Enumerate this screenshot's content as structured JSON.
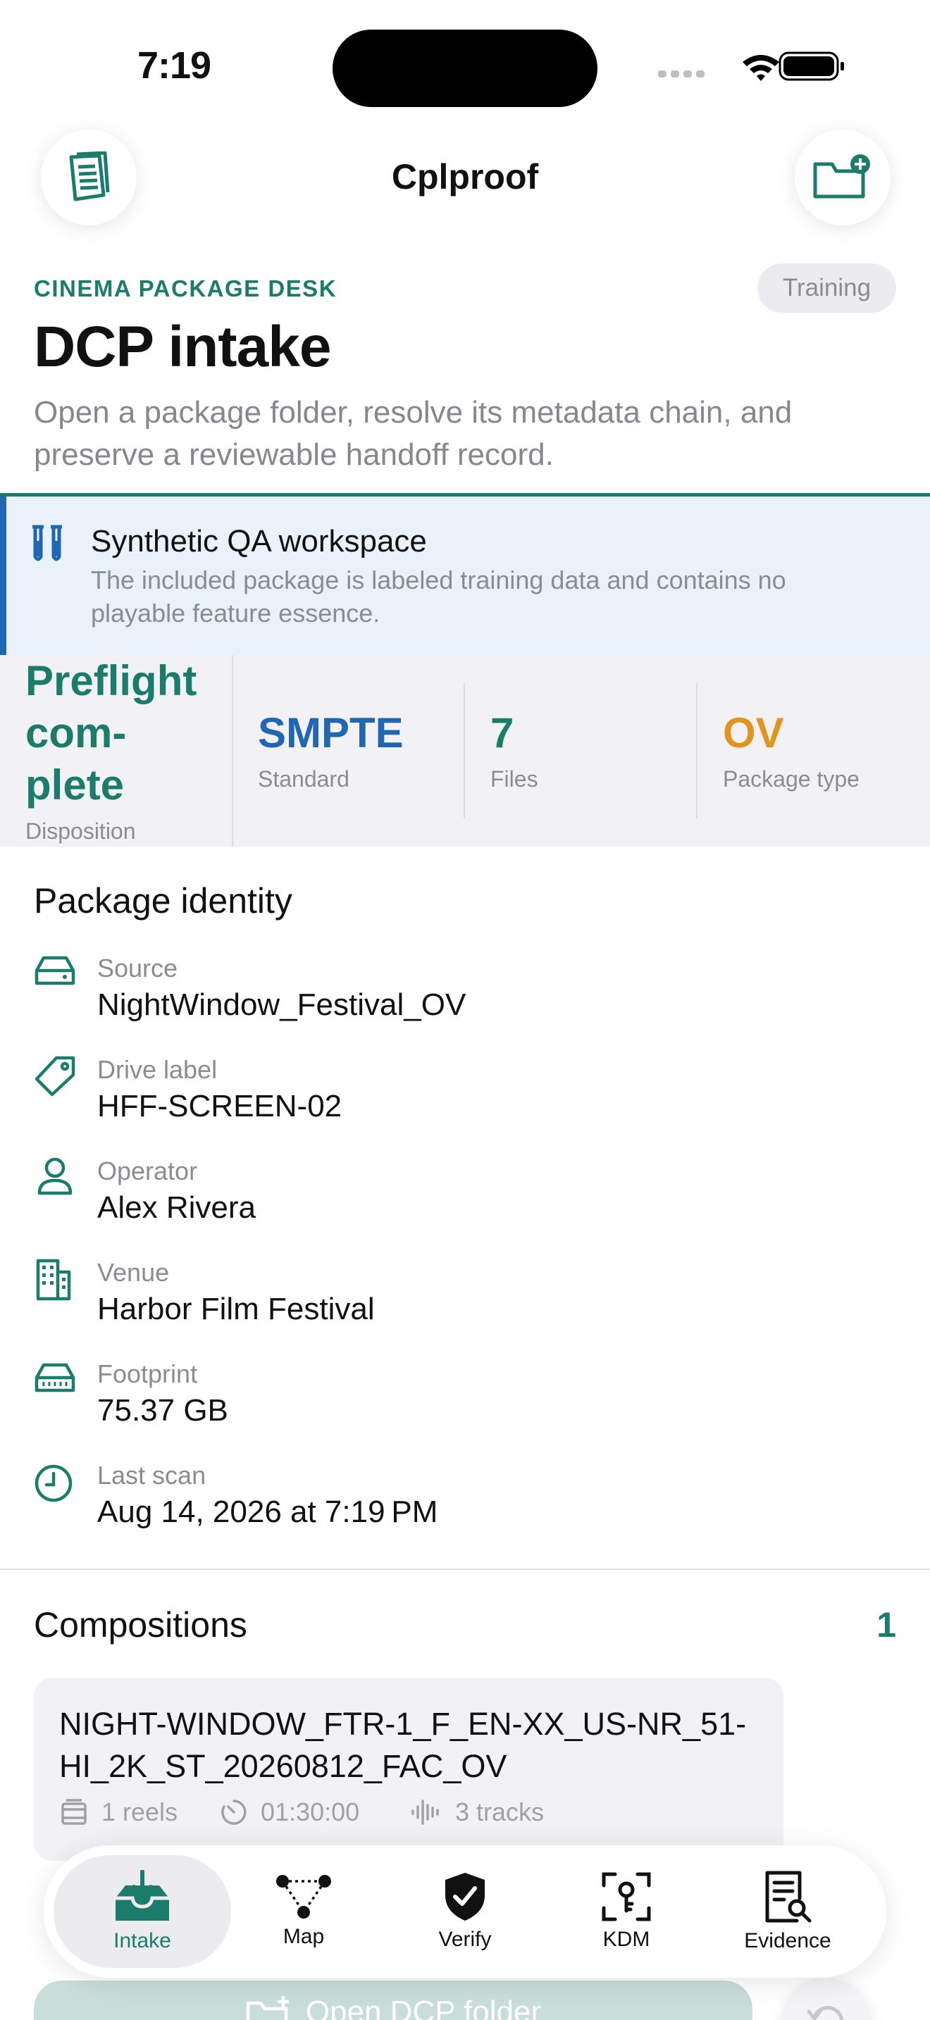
{
  "status_bar": {
    "time": "7:19"
  },
  "nav": {
    "title": "Cplproof",
    "left_icon": "document-icon",
    "right_icon": "folder-plus-icon"
  },
  "header": {
    "eyebrow": "CINEMA PACKAGE DESK",
    "badge": "Training",
    "title": "DCP intake",
    "description": "Open a package folder, resolve its metadata chain, and preserve a reviewable handoff record."
  },
  "banner": {
    "title": "Synthetic QA workspace",
    "text": "The included package is labeled training data and contains no playable feature essence."
  },
  "metrics": [
    {
      "value": "Preflight com-\nplete",
      "label": "Disposition",
      "color": "#1b7c6b"
    },
    {
      "value": "SMPTE",
      "label": "Standard",
      "color": "#2166b3"
    },
    {
      "value": "7",
      "label": "Files",
      "color": "#1b7c6b"
    },
    {
      "value": "OV",
      "label": "Package type",
      "color": "#e0951f"
    }
  ],
  "identity": {
    "title": "Package identity",
    "rows": [
      {
        "icon": "drive-icon",
        "label": "Source",
        "value": "NightWindow_Festival_OV"
      },
      {
        "icon": "tag-icon",
        "label": "Drive label",
        "value": "HFF-SCREEN-02"
      },
      {
        "icon": "person-icon",
        "label": "Operator",
        "value": "Alex Rivera"
      },
      {
        "icon": "building-icon",
        "label": "Venue",
        "value": "Harbor Film Festival"
      },
      {
        "icon": "storage-icon",
        "label": "Footprint",
        "value": "75.37 GB"
      },
      {
        "icon": "clock-icon",
        "label": "Last scan",
        "value": "Aug 14, 2026 at 7:19 PM"
      }
    ]
  },
  "compositions": {
    "title": "Compositions",
    "count": "1",
    "items": [
      {
        "title": "NIGHT-WINDOW_FTR-1_F_EN-XX_US-NR_51-HI_2K_ST_20260812_FAC_OV",
        "reels": "1 reels",
        "duration": "01:30:00",
        "tracks": "3 tracks"
      }
    ]
  },
  "tabs": [
    {
      "label": "Intake",
      "icon": "tray-download-icon",
      "active": true
    },
    {
      "label": "Map",
      "icon": "graph-icon",
      "active": false
    },
    {
      "label": "Verify",
      "icon": "shield-check-icon",
      "active": false
    },
    {
      "label": "KDM",
      "icon": "key-scan-icon",
      "active": false
    },
    {
      "label": "Evidence",
      "icon": "document-search-icon",
      "active": false
    }
  ],
  "cta": {
    "label": "Open DCP folder"
  },
  "colors": {
    "accent": "#1b7c6b",
    "blue": "#2166b3",
    "orange": "#e0951f"
  }
}
